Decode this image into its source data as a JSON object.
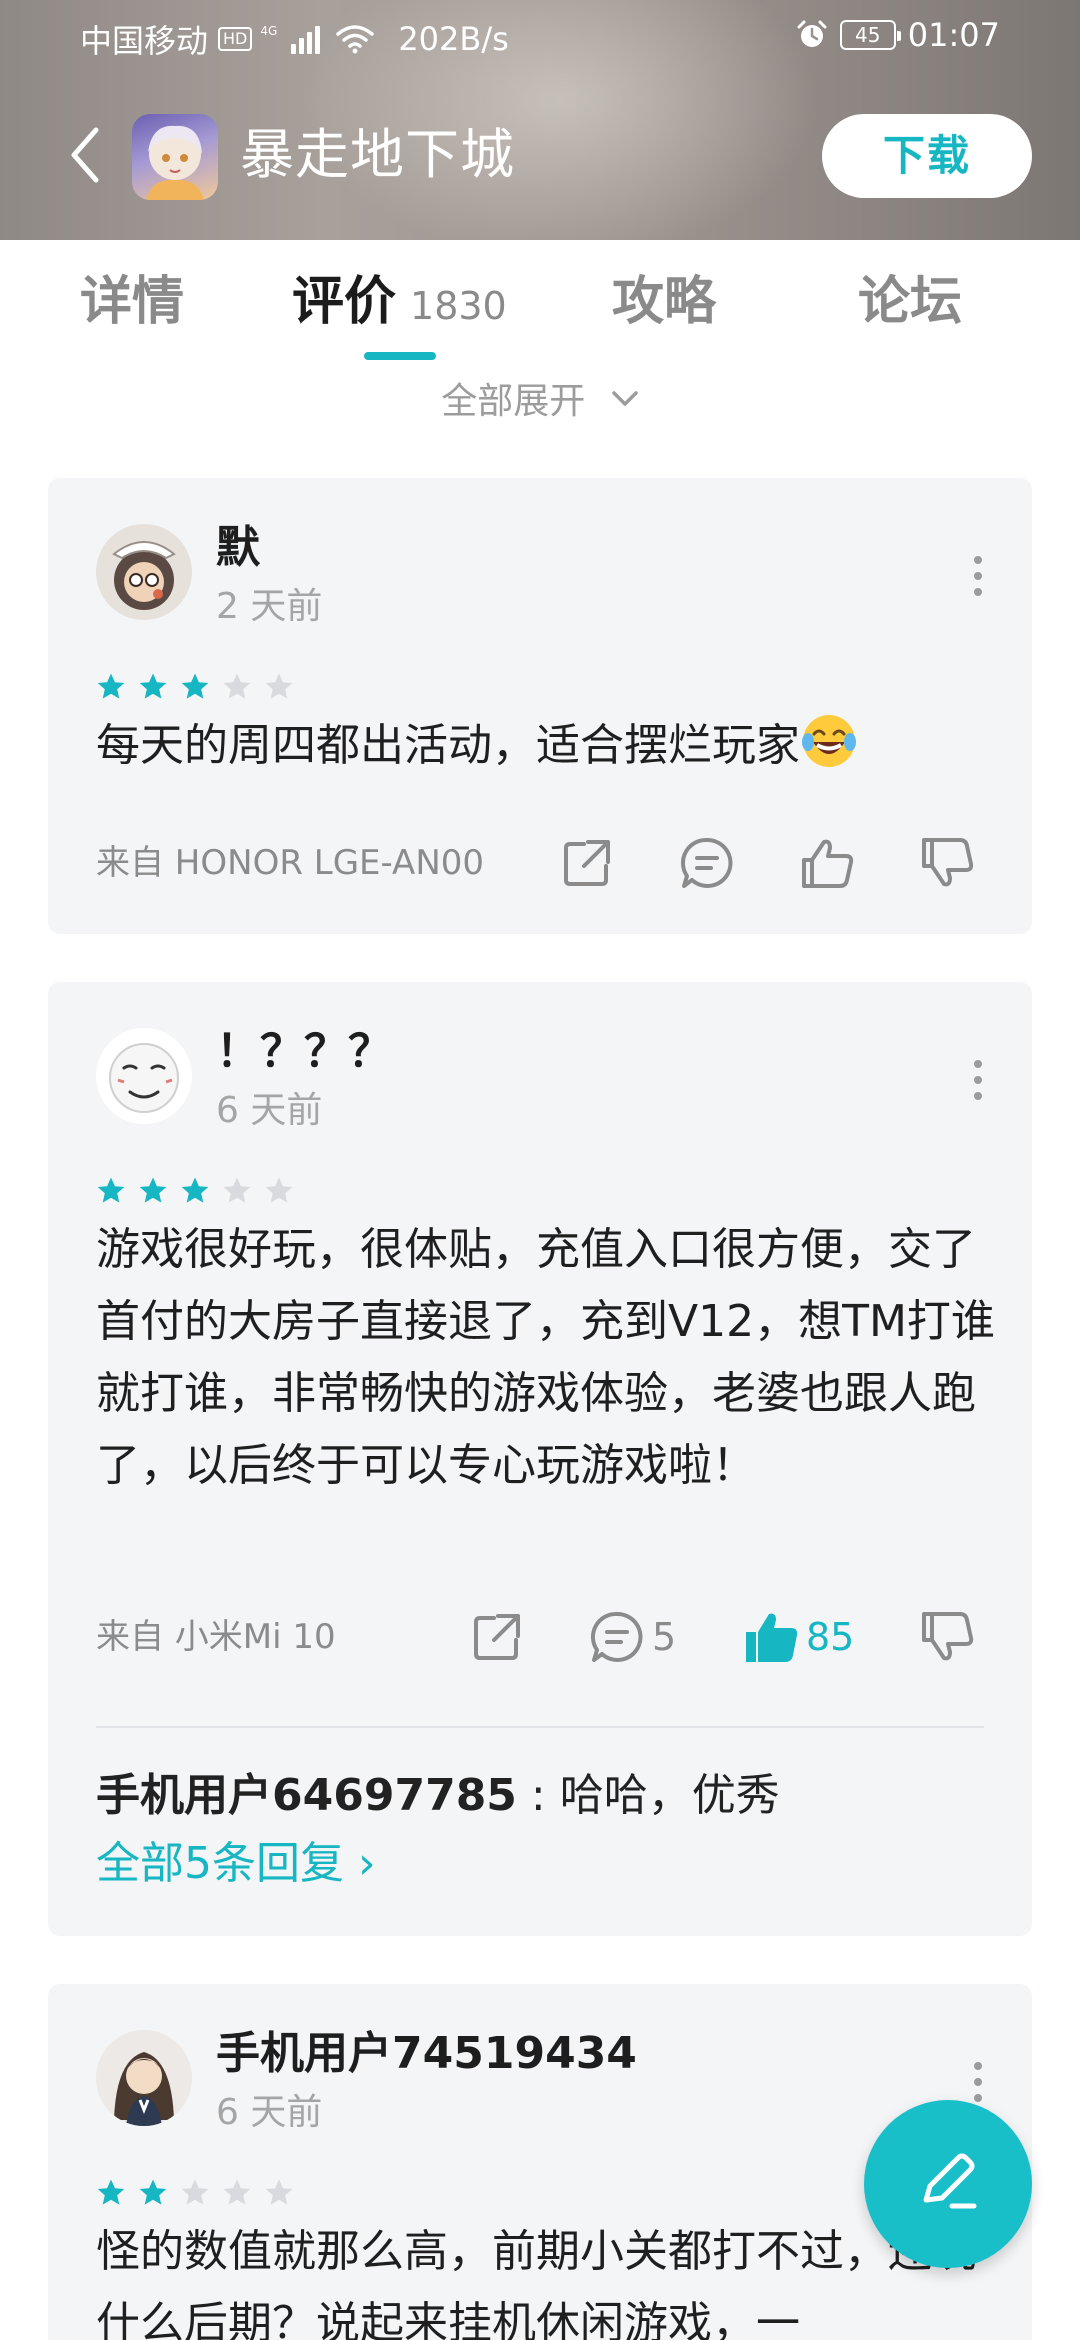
{
  "status_bar": {
    "carrier": "中国移动",
    "hd": "HD",
    "network": "4G",
    "speed": "202B/s",
    "battery": "45",
    "time": "01:07"
  },
  "app_bar": {
    "title": "暴走地下城",
    "download_label": "下载"
  },
  "tabs": [
    {
      "label": "详情",
      "active": false
    },
    {
      "label": "评价",
      "count": "1830",
      "active": true
    },
    {
      "label": "攻略",
      "active": false
    },
    {
      "label": "论坛",
      "active": false
    }
  ],
  "expand_all_label": "全部展开",
  "accent_color": "#16b6c2",
  "reviews": [
    {
      "username": "默",
      "time": "2 天前",
      "rating": 3,
      "text": "每天的周四都出活动，适合摆烂玩家",
      "emoji": "laughing-tears",
      "device": "来自 HONOR LGE-AN00",
      "comment_count": "",
      "like_count": ""
    },
    {
      "username": "！？？？",
      "time": "6 天前",
      "rating": 3,
      "text": "游戏很好玩，很体贴，充值入口很方便，交了首付的大房子直接退了，充到V12，想TM打谁就打谁，非常畅快的游戏体验，老婆也跟人跑了，以后终于可以专心玩游戏啦！",
      "device": "来自 小米Mi 10",
      "comment_count": "5",
      "like_count": "85",
      "liked": true,
      "reply": {
        "user": "手机用户64697785",
        "separator": " : ",
        "text": "哈哈，优秀",
        "all_replies_label": "全部5条回复 ›"
      }
    },
    {
      "username": "手机用户74519434",
      "time": "6 天前",
      "rating": 2,
      "text": "怪的数值就那么高，前期小关都打不过，还玩什么后期？说起来挂机休闲游戏，一"
    }
  ]
}
